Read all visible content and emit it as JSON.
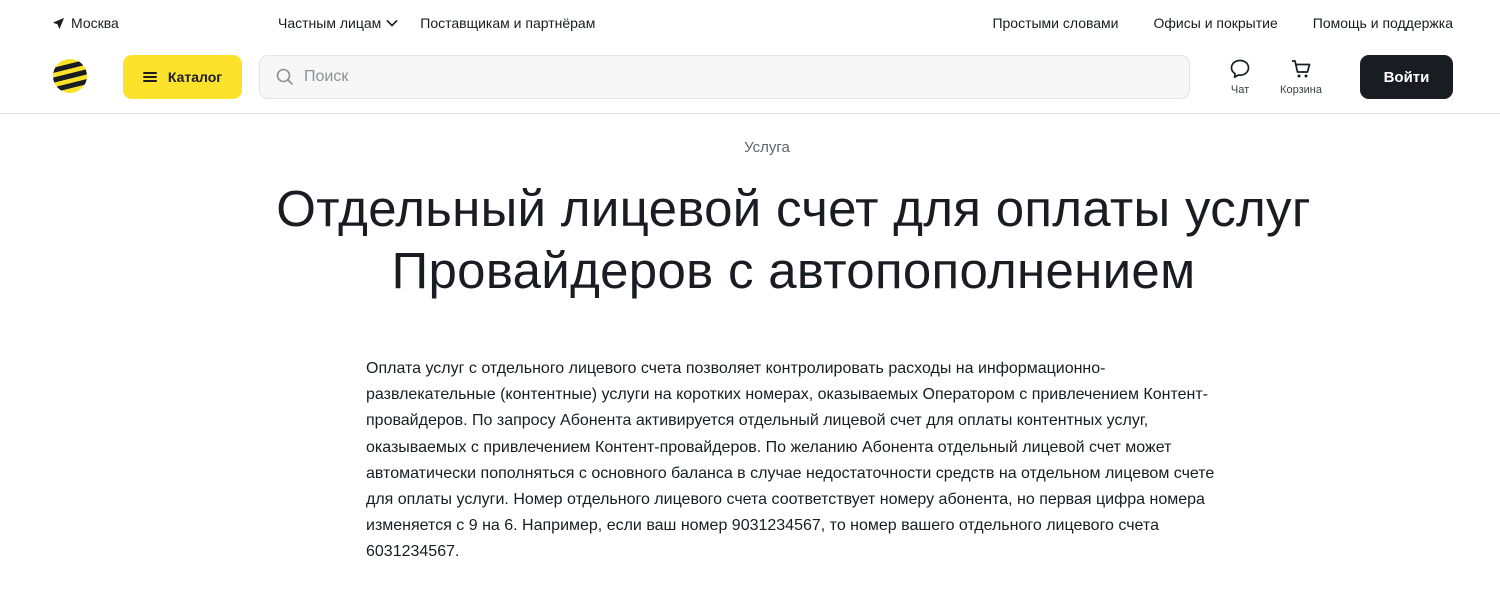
{
  "topbar": {
    "city": "Москва",
    "left_nav": [
      {
        "label": "Частным лицам",
        "dropdown": true
      },
      {
        "label": "Поставщикам и партнёрам",
        "dropdown": false
      }
    ],
    "right_nav": [
      {
        "label": "Простыми словами"
      },
      {
        "label": "Офисы и покрытие"
      },
      {
        "label": "Помощь и поддержка"
      }
    ]
  },
  "header": {
    "logo_icon": "beeline-logo-icon",
    "catalog_label": "Каталог",
    "search_placeholder": "Поиск",
    "search_value": "",
    "chat_label": "Чат",
    "cart_label": "Корзина",
    "login_label": "Войти"
  },
  "main": {
    "eyebrow": "Услуга",
    "title_line1": "Отдельный лицевой счет для  оплаты услуг",
    "title_line2": "Провайдеров  с автопополнением",
    "description": "Оплата услуг с отдельного лицевого счета позволяет контролировать расходы на информационно-развлекательные (контентные) услуги на коротких номерах, оказываемых Оператором с привлечением Контент-провайдеров. По запросу Абонента  активируется отдельный лицевой счет для оплаты контентных услуг, оказываемых с привлечением Контент-провайдеров. По желанию Абонента отдельный лицевой счет может автоматически пополняться с основного баланса в случае недостаточности средств на отдельном лицевом счете для оплаты услуги. Номер отдельного лицевого счета соответствует номеру абонента, но первая цифра номера изменяется с 9  на 6. Например, если ваш номер 9031234567, то номер вашего отдельного лицевого счета 6031234567."
  },
  "colors": {
    "accent_yellow": "#fce22b",
    "dark": "#191c22",
    "muted_text": "#60636a",
    "border": "#e3e4e6"
  }
}
